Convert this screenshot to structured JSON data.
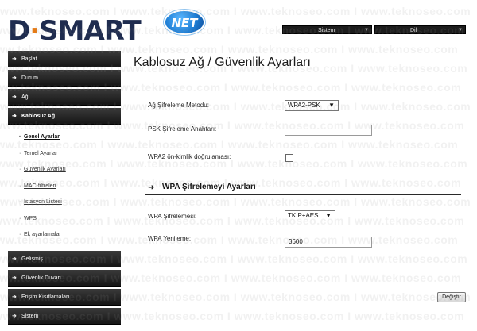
{
  "brand": {
    "logo_text_left": "D",
    "logo_text_sep": "·",
    "logo_text_right": "SMART",
    "logo_badge": "NET"
  },
  "topbar": {
    "system_select": "Sistem",
    "language_select": "Dil"
  },
  "sidebar": {
    "items": [
      {
        "label": "Başlat"
      },
      {
        "label": "Durum"
      },
      {
        "label": "Ağ"
      },
      {
        "label": "Kablosuz Ağ"
      },
      {
        "label": "Gelişmiş"
      },
      {
        "label": "Güvenlik Duvarı"
      },
      {
        "label": "Erişim Kısıtlamaları"
      },
      {
        "label": "Sistem"
      }
    ],
    "subitems": [
      {
        "label": "Genel Ayarlar"
      },
      {
        "label": "Temel Ayarlar"
      },
      {
        "label": "Güvenlik Ayarları"
      },
      {
        "label": "MAC-filtreleri"
      },
      {
        "label": "İstasyon Listesi"
      },
      {
        "label": "WPS"
      },
      {
        "label": "Ek ayarlamalar"
      }
    ]
  },
  "main": {
    "title": "Kablosuz Ağ  / Güvenlik Ayarları",
    "encryption_method_label": "Ağ Şifreleme Metodu:",
    "encryption_method_value": "WPA2-PSK",
    "psk_key_label": "PSK Şifreleme Anahtarı:",
    "psk_key_value": "",
    "preauth_label": "WPA2 ön-kimlik doğrulaması:",
    "wpa_section_title": "WPA Şifrelemeyi Ayarları",
    "wpa_encryption_label": "WPA Şifrelemesi:",
    "wpa_encryption_value": "TKIP+AES",
    "wpa_renewal_label": "WPA Yenileme:",
    "wpa_renewal_value": "3600",
    "apply_button": "Değiştir"
  },
  "watermark": "www.teknoseo.com  I  www.teknoseo.com  I  www.teknoseo.com  I  www.teknoseo.com"
}
